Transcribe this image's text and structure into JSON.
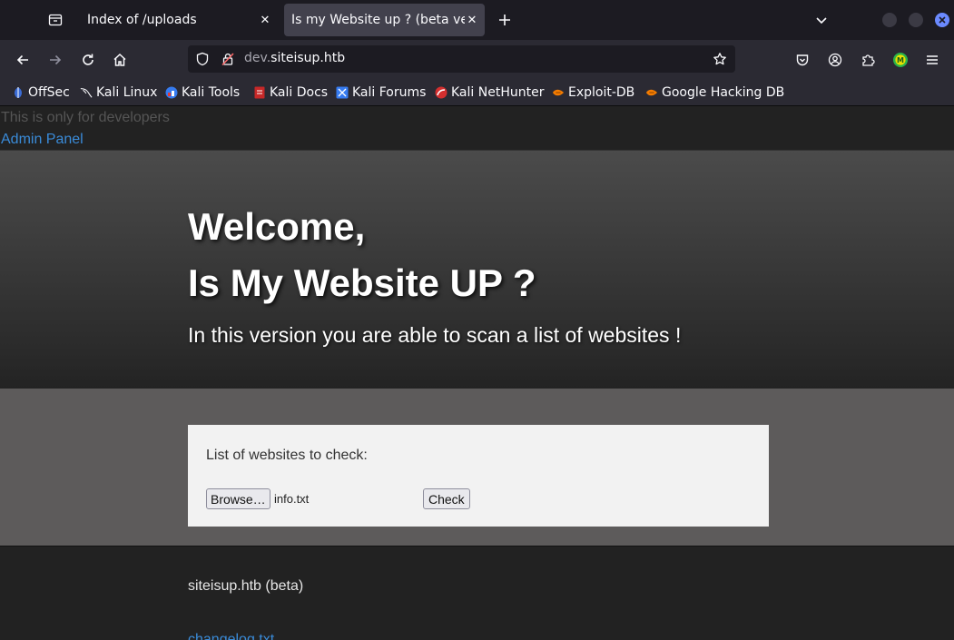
{
  "browser": {
    "tabs": [
      {
        "title": "Index of /uploads",
        "active": false
      },
      {
        "title": "Is my Website up ? (beta version)",
        "active": true
      }
    ],
    "url": {
      "domain_prefix": "dev.",
      "domain_main": "siteisup.htb"
    },
    "bookmarks": [
      {
        "label": "OffSec",
        "icon": "offsec-icon"
      },
      {
        "label": "Kali Linux",
        "icon": "kali-dragon-icon"
      },
      {
        "label": "Kali Tools",
        "icon": "kali-tools-icon"
      },
      {
        "label": "Kali Docs",
        "icon": "kali-docs-icon"
      },
      {
        "label": "Kali Forums",
        "icon": "kali-forums-icon"
      },
      {
        "label": "Kali NetHunter",
        "icon": "nethunter-icon"
      },
      {
        "label": "Exploit-DB",
        "icon": "exploit-db-icon"
      },
      {
        "label": "Google Hacking DB",
        "icon": "ghdb-icon"
      }
    ],
    "colors": {
      "accent": "#6b8aff",
      "tab_active": "#42414d",
      "toolbar": "#2b2a33"
    }
  },
  "page": {
    "dev_note": "This is only for developers",
    "admin_link": "Admin Panel",
    "hero": {
      "welcome": "Welcome,",
      "title": "Is My Website UP ?",
      "subtitle": "In this version you are able to scan a list of websites !"
    },
    "form": {
      "label": "List of websites to check:",
      "browse_label": "Browse…",
      "file_name": "info.txt",
      "submit_label": "Check"
    },
    "footer": {
      "text": "siteisup.htb (beta)",
      "link": "changelog.txt"
    }
  }
}
